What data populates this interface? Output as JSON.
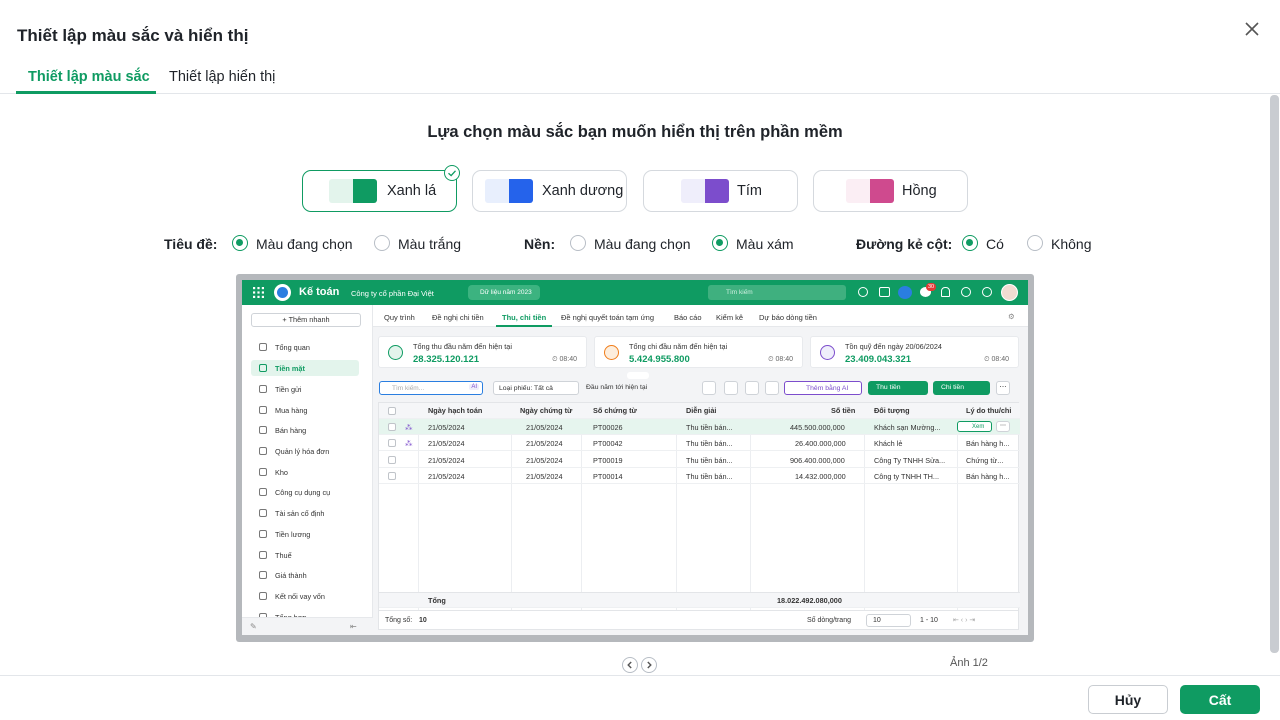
{
  "dialog": {
    "title": "Thiết lập màu sắc và hiển thị",
    "close_icon": "close-icon"
  },
  "tabs": [
    {
      "label": "Thiết lập màu sắc",
      "active": true
    },
    {
      "label": "Thiết lập hiển thị",
      "active": false
    }
  ],
  "heading": "Lựa chọn màu sắc bạn muốn hiển thị trên phần mềm",
  "swatches": [
    {
      "label": "Xanh lá",
      "light": "#e3f4ec",
      "dark": "#0f9b62",
      "selected": true
    },
    {
      "label": "Xanh dương",
      "light": "#e8effd",
      "dark": "#2563eb",
      "selected": false
    },
    {
      "label": "Tím",
      "light": "#efeefb",
      "dark": "#7c4dcc",
      "selected": false
    },
    {
      "label": "Hồng",
      "light": "#fbeef4",
      "dark": "#cf4a8e",
      "selected": false
    }
  ],
  "options": {
    "title_label": "Tiêu đề:",
    "title_current": "Màu đang chọn",
    "title_white": "Màu trắng",
    "bg_label": "Nền:",
    "bg_current": "Màu đang chọn",
    "bg_gray": "Màu xám",
    "col_label": "Đường kẻ cột:",
    "col_yes": "Có",
    "col_no": "Không",
    "title_selected": "Màu đang chọn",
    "bg_selected": "Màu xám",
    "col_selected": "Có"
  },
  "preview": {
    "app_name": "Kế toán",
    "company": "Công ty cổ phần Đại Việt",
    "data_year": "Dữ liệu năm 2023",
    "search_placeholder": "Tìm kiếm",
    "notif_count": "30",
    "quick_add": "Thêm nhanh",
    "nav": [
      {
        "label": "Tổng quan",
        "active": false
      },
      {
        "label": "Tiền mặt",
        "active": true
      },
      {
        "label": "Tiền gửi",
        "active": false
      },
      {
        "label": "Mua hàng",
        "active": false
      },
      {
        "label": "Bán hàng",
        "active": false
      },
      {
        "label": "Quản lý hóa đơn",
        "active": false
      },
      {
        "label": "Kho",
        "active": false
      },
      {
        "label": "Công cụ dụng cụ",
        "active": false
      },
      {
        "label": "Tài sản cố định",
        "active": false
      },
      {
        "label": "Tiền lương",
        "active": false
      },
      {
        "label": "Thuế",
        "active": false
      },
      {
        "label": "Giá thành",
        "active": false
      },
      {
        "label": "Kết nối vay vốn",
        "active": false
      },
      {
        "label": "Tổng hợp",
        "active": false
      }
    ],
    "subtabs": [
      "Quy trình",
      "Đề nghị chi tiền",
      "Thu, chi tiền",
      "Đề nghị quyết toán tạm ứng",
      "Báo cáo",
      "Kiểm kê",
      "Dự báo dòng tiền"
    ],
    "active_subtab": "Thu, chi tiền",
    "cards": [
      {
        "label": "Tổng thu đầu năm đến hiện tại",
        "value": "28.325.120.121",
        "time": "08:40",
        "color": "#0f9b62"
      },
      {
        "label": "Tổng chi đầu năm đến hiện tại",
        "value": "5.424.955.800",
        "time": "08:40",
        "color": "#f07d1a"
      },
      {
        "label": "Tồn quỹ đến ngày 20/06/2024",
        "value": "23.409.043.321",
        "time": "08:40",
        "color": "#7c4dcc"
      }
    ],
    "toolbar": {
      "search": "Tìm kiếm...",
      "ai": "AI",
      "type_filter": "Loại phiếu: Tất cả",
      "period": "Đầu năm tới hiện tại",
      "add_ai": "Thêm bằng AI",
      "receive": "Thu tiền",
      "pay": "Chi tiền"
    },
    "columns": [
      "Ngày hạch toán",
      "Ngày chứng từ",
      "Số chứng từ",
      "Diễn giải",
      "Số tiền",
      "Đối tượng",
      "Lý do thu/chi"
    ],
    "rows": [
      {
        "acc_date": "21/05/2024",
        "doc_date": "21/05/2024",
        "doc_no": "PT00026",
        "desc": "Thu tiền bán...",
        "amount": "445.500.000,000",
        "party": "Khách sạn Mường...",
        "reason": ""
      },
      {
        "acc_date": "21/05/2024",
        "doc_date": "21/05/2024",
        "doc_no": "PT00042",
        "desc": "Thu tiền bán...",
        "amount": "26.400.000,000",
        "party": "Khách lẻ",
        "reason": "Bán hàng h..."
      },
      {
        "acc_date": "21/05/2024",
        "doc_date": "21/05/2024",
        "doc_no": "PT00019",
        "desc": "Thu tiền bán...",
        "amount": "906.400.000,000",
        "party": "Công Ty TNHH Sửa...",
        "reason": "Chứng từ..."
      },
      {
        "acc_date": "21/05/2024",
        "doc_date": "21/05/2024",
        "doc_no": "PT00014",
        "desc": "Thu tiền bán...",
        "amount": "14.432.000,000",
        "party": "Công ty TNHH TH...",
        "reason": "Bán hàng h..."
      }
    ],
    "view_btn": "Xem",
    "total_label": "Tổng",
    "total_amount": "18.022.492.080,000",
    "count_label": "Tổng số:",
    "count": "10",
    "per_page_label": "Số dòng/trang",
    "per_page": "10",
    "range": "1 - 10"
  },
  "pager_text": "Ảnh 1/2",
  "footer": {
    "cancel": "Hủy",
    "save": "Cất"
  }
}
